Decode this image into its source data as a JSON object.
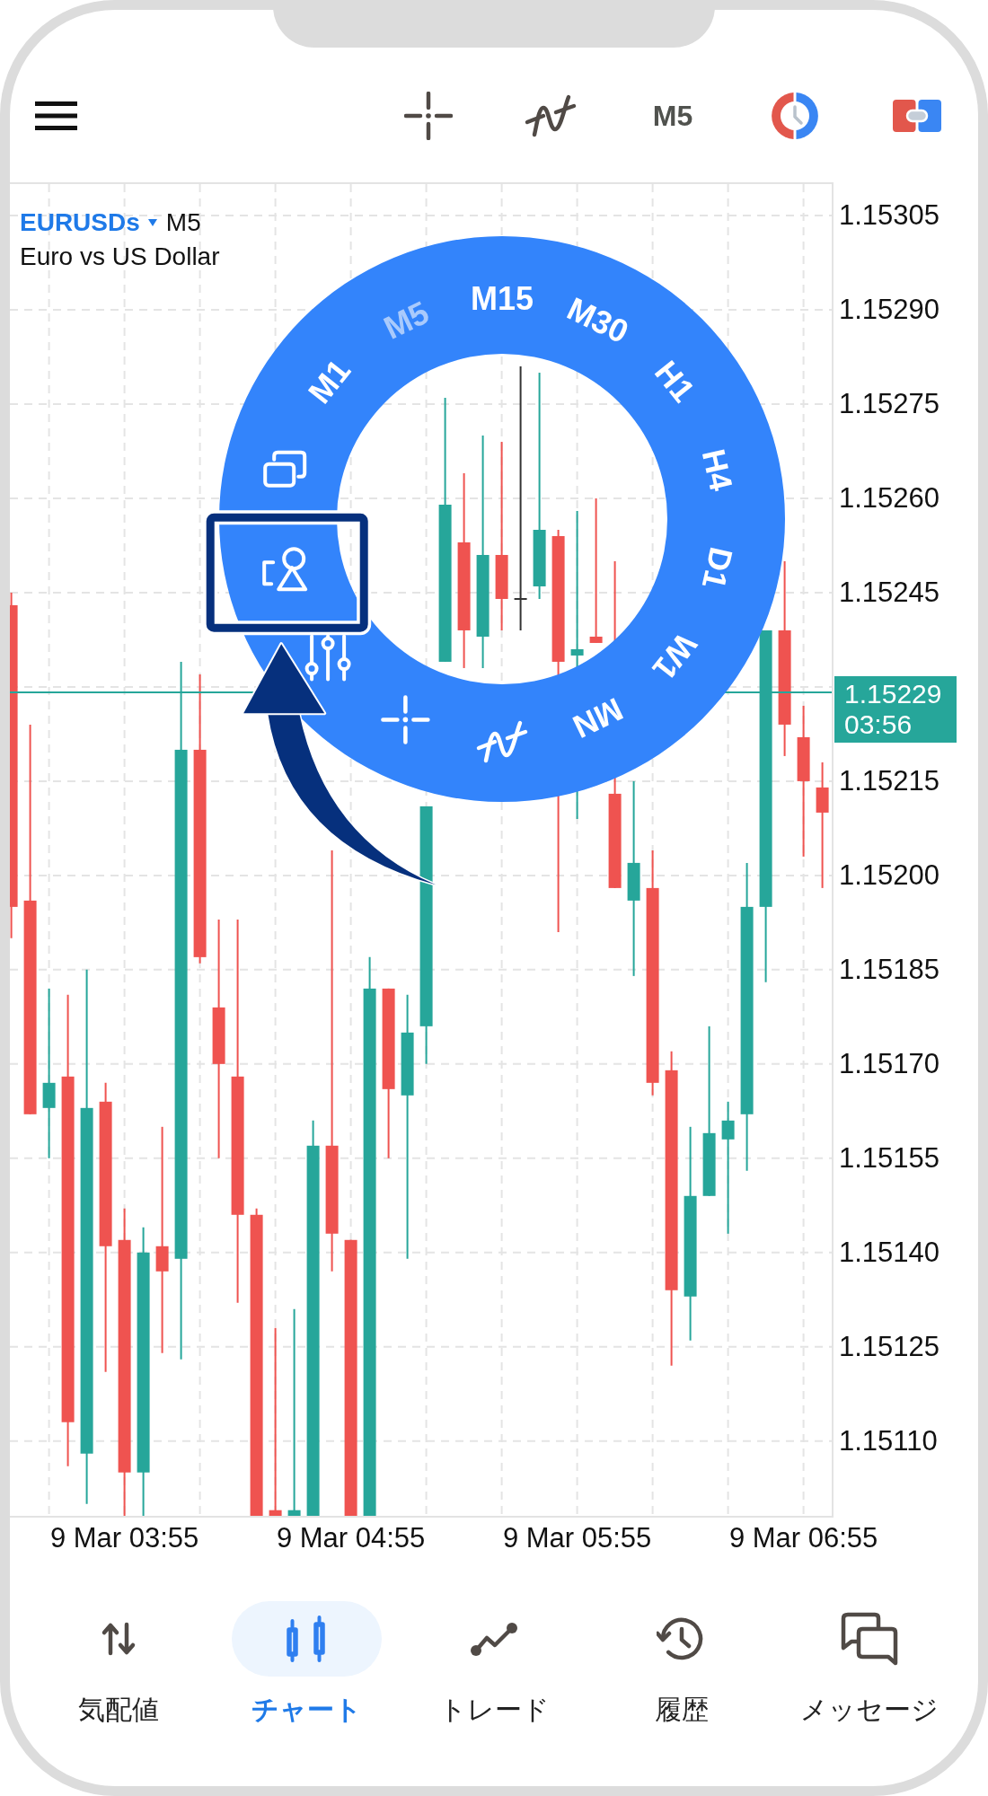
{
  "toolbar": {
    "timeframe": "M5"
  },
  "chart": {
    "symbol": "EURUSDs",
    "timeframe": "M5",
    "description": "Euro vs US Dollar",
    "current_price": {
      "price": "1.15229",
      "countdown": "03:56"
    },
    "chart_data": {
      "type": "candlestick",
      "categories": [
        null,
        null,
        null,
        null,
        null,
        null,
        "9 Mar 03:55",
        null,
        null,
        null,
        null,
        null,
        null,
        null,
        null,
        null,
        null,
        null,
        "9 Mar 04:55",
        null,
        null,
        null,
        null,
        null,
        null,
        null,
        null,
        null,
        null,
        null,
        "9 Mar 05:55",
        null,
        null,
        null,
        null,
        null,
        null,
        null,
        null,
        null,
        null,
        null,
        "9 Mar 06:55",
        null
      ],
      "ohlc": [
        [
          1.15243,
          1.15245,
          1.1519,
          1.15195
        ],
        [
          1.15196,
          1.15224,
          1.15162,
          1.15162
        ],
        [
          1.15163,
          1.15182,
          1.15155,
          1.15167
        ],
        [
          1.15168,
          1.15181,
          1.15106,
          1.15113
        ],
        [
          1.15108,
          1.15185,
          1.151,
          1.15163
        ],
        [
          1.15164,
          1.15167,
          1.15121,
          1.15141
        ],
        [
          1.15142,
          1.15147,
          1.15098,
          1.15105
        ],
        [
          1.15105,
          1.15144,
          1.15098,
          1.1514
        ],
        [
          1.15141,
          1.1516,
          1.15124,
          1.15137
        ],
        [
          1.15139,
          1.15234,
          1.15123,
          1.1522
        ],
        [
          1.1522,
          1.15232,
          1.15186,
          1.15187
        ],
        [
          1.15179,
          1.15193,
          1.15155,
          1.1517
        ],
        [
          1.15168,
          1.15193,
          1.15132,
          1.15146
        ],
        [
          1.15146,
          1.15147,
          1.15098,
          1.15098
        ],
        [
          1.15099,
          1.15128,
          1.15098,
          1.15098
        ],
        [
          1.15098,
          1.15131,
          1.15098,
          1.15099
        ],
        [
          1.15098,
          1.15161,
          1.15098,
          1.15157
        ],
        [
          1.15157,
          1.15204,
          1.15137,
          1.15143
        ],
        [
          1.15142,
          1.15142,
          1.15098,
          1.15098
        ],
        [
          1.15098,
          1.15187,
          1.15098,
          1.15182
        ],
        [
          1.15182,
          1.15182,
          1.15155,
          1.15166
        ],
        [
          1.15165,
          1.15181,
          1.15139,
          1.15175
        ],
        [
          1.15176,
          1.15211,
          1.1517,
          1.15211
        ],
        [
          1.15234,
          1.15276,
          1.15234,
          1.15259
        ],
        [
          1.15253,
          1.15264,
          1.15233,
          1.15239
        ],
        [
          1.15238,
          1.1527,
          1.15233,
          1.15251
        ],
        [
          1.15251,
          1.15269,
          1.15239,
          1.15244
        ],
        [
          1.15244,
          1.15281,
          1.15239,
          1.15244
        ],
        [
          1.15246,
          1.1528,
          1.15244,
          1.15255
        ],
        [
          1.15254,
          1.15255,
          1.15191,
          1.15234
        ],
        [
          1.15235,
          1.15258,
          1.15209,
          1.15236
        ],
        [
          1.15238,
          1.1526,
          1.15237,
          1.15237
        ],
        [
          1.15213,
          1.1525,
          1.15198,
          1.15198
        ],
        [
          1.15196,
          1.15215,
          1.15184,
          1.15202
        ],
        [
          1.15198,
          1.15204,
          1.15165,
          1.15167
        ],
        [
          1.15169,
          1.15172,
          1.15122,
          1.15134
        ],
        [
          1.15133,
          1.1516,
          1.15126,
          1.15149
        ],
        [
          1.15149,
          1.15176,
          1.15149,
          1.15159
        ],
        [
          1.15158,
          1.15164,
          1.15143,
          1.15161
        ],
        [
          1.15162,
          1.15202,
          1.15153,
          1.15195
        ],
        [
          1.15195,
          1.15239,
          1.15183,
          1.15239
        ],
        [
          1.15239,
          1.1525,
          1.15219,
          1.15224
        ],
        [
          1.15222,
          1.15227,
          1.15203,
          1.15215
        ],
        [
          1.15214,
          1.15218,
          1.15198,
          1.1521
        ]
      ],
      "ylim": [
        1.150981,
        1.153103
      ],
      "yticks": [
        {
          "value": 1.15305,
          "label": "1.15305"
        },
        {
          "value": 1.1529,
          "label": "1.15290"
        },
        {
          "value": 1.15275,
          "label": "1.15275"
        },
        {
          "value": 1.1526,
          "label": "1.15260"
        },
        {
          "value": 1.15245,
          "label": "1.15245"
        },
        {
          "value": 1.15215,
          "label": "1.15215"
        },
        {
          "value": 1.152,
          "label": "1.15200"
        },
        {
          "value": 1.15185,
          "label": "1.15185"
        },
        {
          "value": 1.1517,
          "label": "1.15170"
        },
        {
          "value": 1.15155,
          "label": "1.15155"
        },
        {
          "value": 1.1514,
          "label": "1.15140"
        },
        {
          "value": 1.15125,
          "label": "1.15125"
        },
        {
          "value": 1.1511,
          "label": "1.15110"
        }
      ],
      "grid": true
    }
  },
  "ring": {
    "timeframes": [
      {
        "label": "M1",
        "selected": false
      },
      {
        "label": "M5",
        "selected": true
      },
      {
        "label": "M15",
        "selected": false
      },
      {
        "label": "M30",
        "selected": false
      },
      {
        "label": "H1",
        "selected": false
      },
      {
        "label": "H4",
        "selected": false
      },
      {
        "label": "D1",
        "selected": false
      },
      {
        "label": "W1",
        "selected": false
      },
      {
        "label": "MN",
        "selected": false
      }
    ],
    "tools": [
      {
        "kind": "windows",
        "highlighted": false
      },
      {
        "kind": "objects",
        "highlighted": true
      },
      {
        "kind": "settings",
        "highlighted": false
      },
      {
        "kind": "crosshair",
        "highlighted": false
      },
      {
        "kind": "indicators",
        "highlighted": false
      }
    ]
  },
  "nav": [
    {
      "kind": "quotes",
      "label": "気配値",
      "selected": false
    },
    {
      "kind": "chart",
      "label": "チャート",
      "selected": true
    },
    {
      "kind": "trade",
      "label": "トレード",
      "selected": false
    },
    {
      "kind": "history",
      "label": "履歴",
      "selected": false
    },
    {
      "kind": "messages",
      "label": "メッセージ",
      "selected": false
    }
  ]
}
